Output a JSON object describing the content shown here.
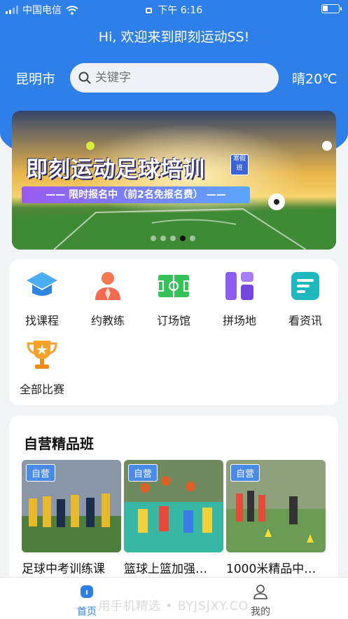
{
  "status_bar": {
    "carrier": "中国电信",
    "time": "下午 6:16"
  },
  "header": {
    "welcome": "Hi, 欢迎来到即刻运动SS!",
    "city": "昆明市",
    "weather": "晴20℃"
  },
  "search": {
    "placeholder": "关键字"
  },
  "banner": {
    "title": "即刻运动足球培训",
    "badge": "寒假班",
    "subtitle": "—— 限时报名中（前2名免报名费） ——",
    "dots_count": 5,
    "active_dot": 3
  },
  "menu": {
    "items": [
      {
        "label": "找课程",
        "icon": "graduation-cap-icon"
      },
      {
        "label": "约教练",
        "icon": "coach-icon"
      },
      {
        "label": "订场馆",
        "icon": "field-icon"
      },
      {
        "label": "拼场地",
        "icon": "grid-icon"
      },
      {
        "label": "看资讯",
        "icon": "news-icon"
      },
      {
        "label": "全部比赛",
        "icon": "trophy-icon"
      }
    ]
  },
  "section": {
    "title": "自营精品班",
    "courses": [
      {
        "tag": "自营",
        "name": "足球中考训练课"
      },
      {
        "tag": "自营",
        "name": "篮球上篮加强…"
      },
      {
        "tag": "自营",
        "name": "1000米精品中…"
      }
    ]
  },
  "tabbar": {
    "items": [
      {
        "label": "首页",
        "active": true
      },
      {
        "label": "我的",
        "active": false
      }
    ]
  },
  "watermark": "用手机精选 • BYJSJXY.CO",
  "colors": {
    "primary": "#2f7fe8",
    "tab_active": "#2f7fe8",
    "tab_inactive": "#555555"
  }
}
